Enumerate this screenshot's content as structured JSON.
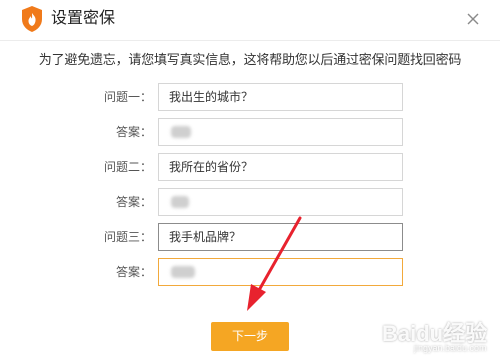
{
  "dialog": {
    "title": "设置密保",
    "close_glyph": "✕",
    "instruction": "为了避免遗忘，请您填写真实信息，这将帮助您以后通过密保问题找回密码"
  },
  "form": {
    "rows": [
      {
        "label": "问题一：",
        "value": "我出生的城市？"
      },
      {
        "label": "答案：",
        "value": ""
      },
      {
        "label": "问题二：",
        "value": "我所在的省份？"
      },
      {
        "label": "答案：",
        "value": ""
      },
      {
        "label": "问题三：",
        "value": "我手机品牌？"
      },
      {
        "label": "答案：",
        "value": ""
      }
    ]
  },
  "next_button": {
    "label": "下一步"
  },
  "watermark": {
    "brand": "Baidu经验",
    "url": "jingyan.baidu.com"
  },
  "colors": {
    "accent": "#f5a623",
    "focused_border": "#f2a93b",
    "arrow": "#e8222e"
  },
  "icons": {
    "app_logo": "flame-shield-icon",
    "close": "close-icon"
  }
}
